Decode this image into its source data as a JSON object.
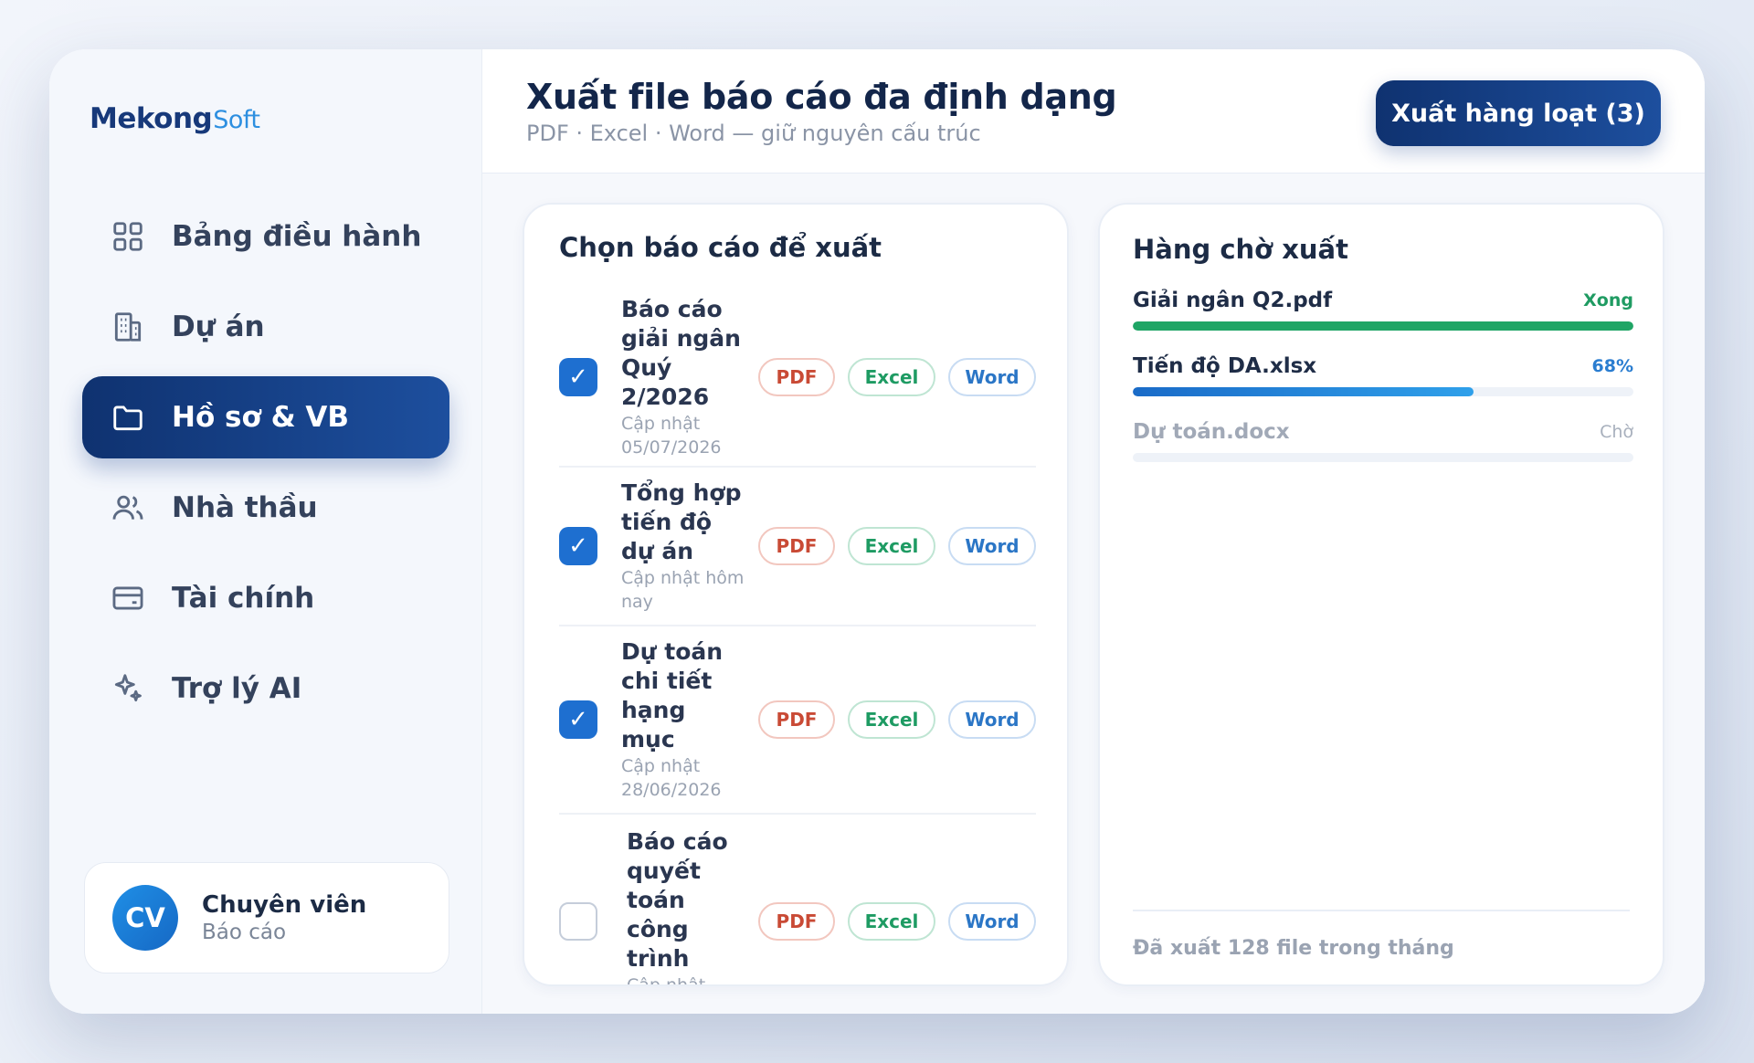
{
  "brand": {
    "name_main": "Mekong",
    "name_sub": "Soft"
  },
  "sidebar": {
    "items": [
      {
        "label": "Bảng điều hành",
        "icon": "grid-icon",
        "active": false
      },
      {
        "label": "Dự án",
        "icon": "building-icon",
        "active": false
      },
      {
        "label": "Hồ sơ & VB",
        "icon": "folder-icon",
        "active": true
      },
      {
        "label": "Nhà thầu",
        "icon": "users-icon",
        "active": false
      },
      {
        "label": "Tài chính",
        "icon": "card-icon",
        "active": false
      },
      {
        "label": "Trợ lý AI",
        "icon": "sparkle-icon",
        "active": false
      }
    ],
    "user": {
      "initials": "CV",
      "name": "Chuyên viên",
      "role": "Báo cáo"
    }
  },
  "header": {
    "title": "Xuất file báo cáo đa định dạng",
    "subtitle": "PDF · Excel · Word — giữ nguyên cấu trúc",
    "bulk_export_label": "Xuất hàng loạt (3)"
  },
  "reports_panel": {
    "title": "Chọn báo cáo để xuất",
    "formats": [
      "PDF",
      "Excel",
      "Word"
    ],
    "reports": [
      {
        "name": "Báo cáo giải ngân Quý 2/2026",
        "date": "Cập nhật 05/07/2026",
        "checked": true
      },
      {
        "name": "Tổng hợp tiến độ dự án",
        "date": "Cập nhật hôm nay",
        "checked": true
      },
      {
        "name": "Dự toán chi tiết hạng mục",
        "date": "Cập nhật 28/06/2026",
        "checked": true
      },
      {
        "name": "Báo cáo quyết toán công trình",
        "date": "Cập nhật",
        "checked": false
      }
    ]
  },
  "queue_panel": {
    "title": "Hàng chờ xuất",
    "items": [
      {
        "file": "Giải ngân Q2.pdf",
        "status": "Xong",
        "progress": 100,
        "state": "done"
      },
      {
        "file": "Tiến độ DA.xlsx",
        "status": "68%",
        "progress": 68,
        "state": "progress"
      },
      {
        "file": "Dự toán.docx",
        "status": "Chờ",
        "progress": 0,
        "state": "wait"
      }
    ],
    "footer": "Đã xuất 128 file trong tháng"
  },
  "colors": {
    "primary": "#0f3270",
    "accent": "#1e6fd0",
    "success": "#1fa565",
    "pdf": "#c94a35",
    "excel": "#1e9b63",
    "word": "#2b76c6"
  }
}
